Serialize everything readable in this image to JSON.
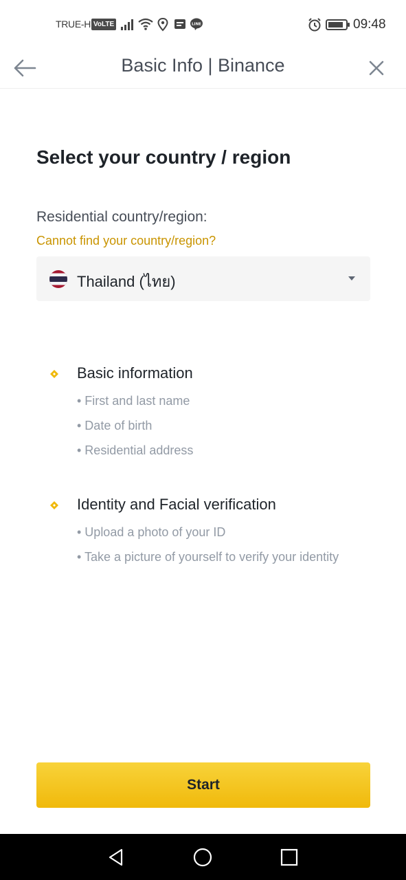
{
  "status_bar": {
    "carrier": "TRUE-H",
    "network_badge": "VoLTE",
    "time": "09:48",
    "icons": [
      "signal-icon",
      "wifi-icon",
      "location-icon",
      "message-icon",
      "line-app-icon",
      "alarm-icon",
      "battery-icon"
    ]
  },
  "header": {
    "title": "Basic Info | Binance"
  },
  "main": {
    "title": "Select your country / region",
    "residence_label": "Residential country/region:",
    "help_link": "Cannot find your country/region?",
    "country": {
      "selected": "Thailand (ไทย)",
      "flag_colors": [
        "#a51931",
        "#f4f5f8",
        "#2d2a4a"
      ]
    },
    "sections": [
      {
        "heading": "Basic information",
        "items": [
          "• First and last name",
          "• Date of birth",
          "• Residential address"
        ]
      },
      {
        "heading": "Identity and Facial verification",
        "items": [
          "• Upload a photo of your ID",
          "• Take a picture of yourself to verify your identity"
        ]
      }
    ],
    "start_button": "Start"
  },
  "colors": {
    "accent": "#f0b90b",
    "link": "#c99400",
    "text_primary": "#1e2329",
    "text_secondary": "#929aa5"
  }
}
